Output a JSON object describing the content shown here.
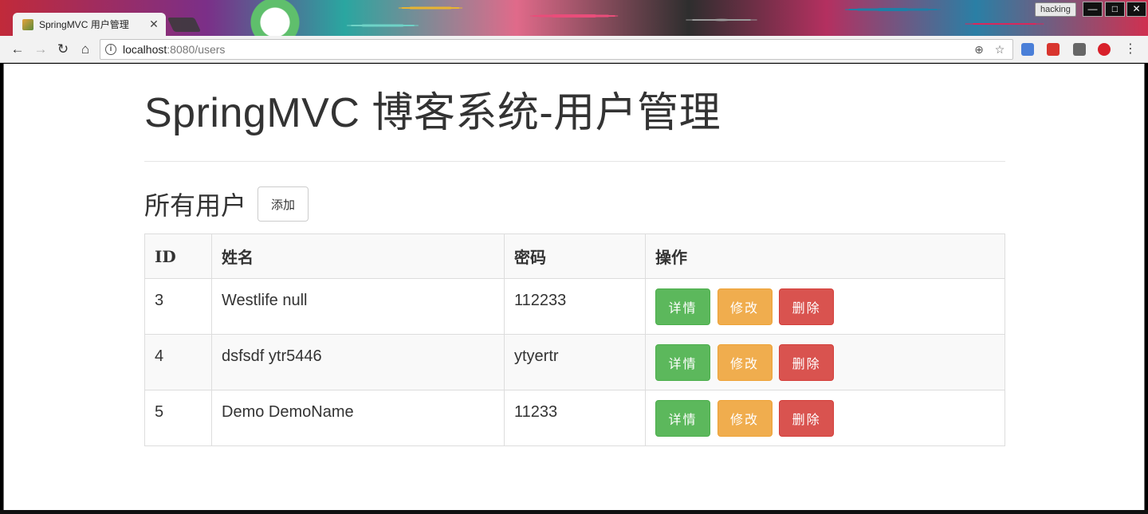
{
  "browser": {
    "tab_title": "SpringMVC 用户管理",
    "profile": "hacking",
    "url_host": "localhost",
    "url_rest": ":8080/users",
    "win_min": "—",
    "win_max": "□",
    "win_close": "✕"
  },
  "page": {
    "title": "SpringMVC 博客系统-用户管理",
    "section_title": "所有用户",
    "add_label": "添加"
  },
  "table": {
    "headers": [
      "ID",
      "姓名",
      "密码",
      "操作"
    ],
    "rows": [
      {
        "id": "3",
        "name": "Westlife null",
        "password": "112233"
      },
      {
        "id": "4",
        "name": "dsfsdf ytr5446",
        "password": "ytyertr"
      },
      {
        "id": "5",
        "name": "Demo DemoName",
        "password": "11233"
      }
    ],
    "actions": {
      "detail": "详情",
      "edit": "修改",
      "delete": "删除"
    }
  },
  "colors": {
    "success": "#5cb85c",
    "warning": "#f0ad4e",
    "danger": "#d9534f"
  }
}
